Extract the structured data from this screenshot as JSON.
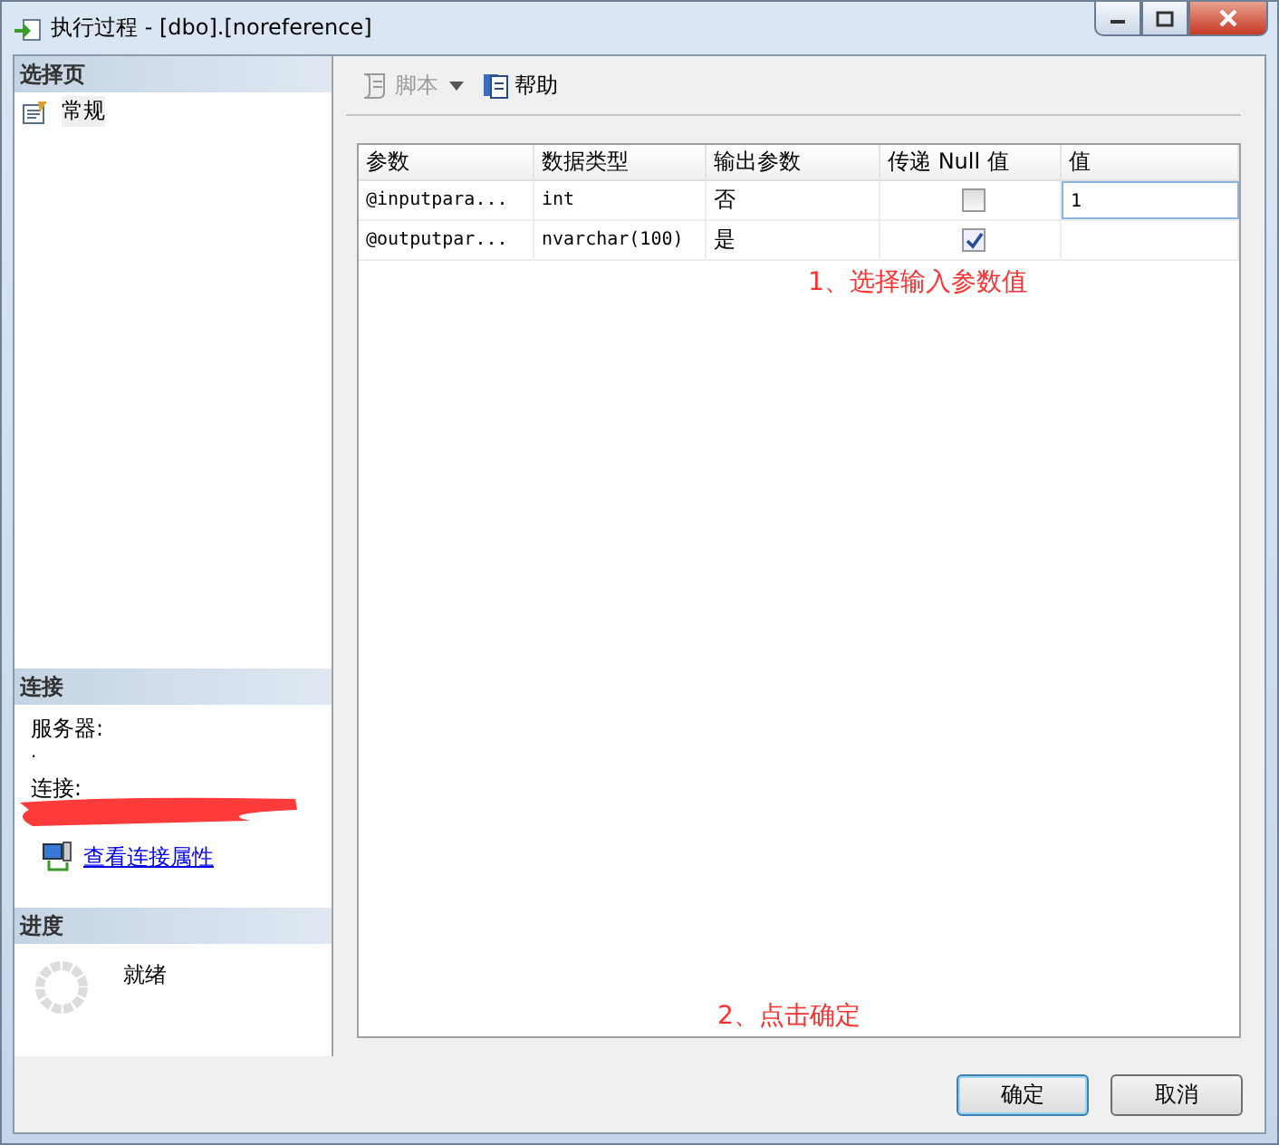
{
  "window": {
    "title": "执行过程 - [dbo].[noreference]"
  },
  "sidebar": {
    "pages_header": "选择页",
    "pages": [
      {
        "label": "常规",
        "selected": true
      }
    ],
    "connection": {
      "header": "连接",
      "server_label": "服务器:",
      "server_value": ".",
      "connection_label": "连接:",
      "link": "查看连接属性"
    },
    "progress": {
      "header": "进度",
      "status": "就绪"
    }
  },
  "toolbar": [
    {
      "kind": "script",
      "label": "脚本",
      "disabled": true
    },
    {
      "kind": "help",
      "label": "帮助",
      "disabled": false
    }
  ],
  "table": {
    "columns": [
      "参数",
      "数据类型",
      "输出参数",
      "传递 Null 值",
      "值"
    ],
    "rows": [
      {
        "parameter": "@inputpara...",
        "type": "int",
        "output": "否",
        "pass_null": false,
        "value": "1",
        "value_focused": true
      },
      {
        "parameter": "@outputpar...",
        "type": "nvarchar(100)",
        "output": "是",
        "pass_null": true,
        "value_focused": false
      }
    ]
  },
  "annotations": [
    "1、选择输入参数值",
    "2、点击确定"
  ],
  "buttons": [
    {
      "label": "确定",
      "default": true
    },
    {
      "label": "取消",
      "default": false
    }
  ]
}
